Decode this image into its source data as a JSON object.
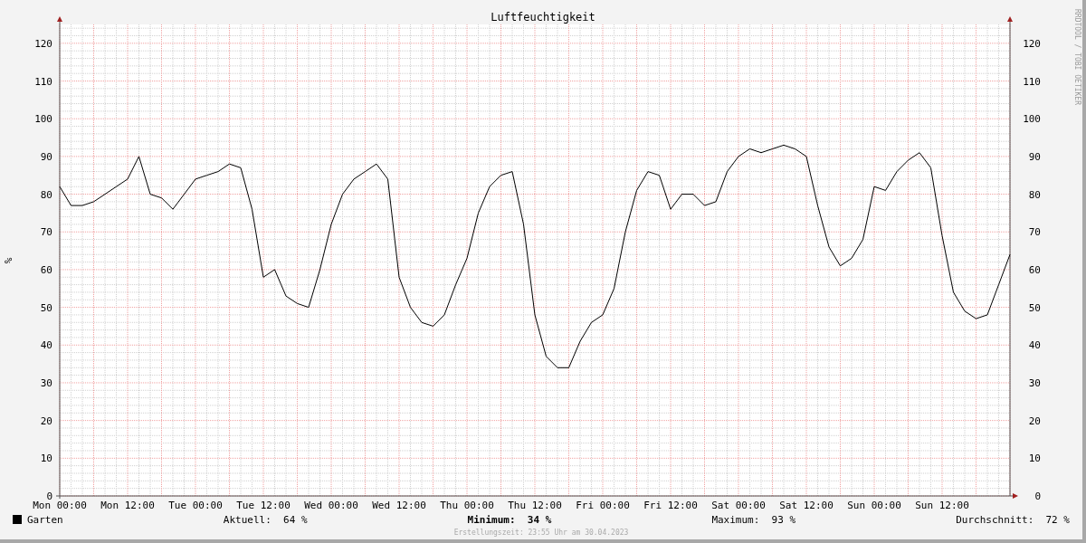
{
  "credit": "RRDTOOL / TOBI OETIKER",
  "chart_data": {
    "type": "line",
    "title": "Luftfeuchtigkeit",
    "ylabel": "%",
    "categories": [
      "Mon 00:00",
      null,
      null,
      null,
      null,
      null,
      "Mon 12:00",
      null,
      null,
      null,
      null,
      null,
      "Tue 00:00",
      null,
      null,
      null,
      null,
      null,
      "Tue 12:00",
      null,
      null,
      null,
      null,
      null,
      "Wed 00:00",
      null,
      null,
      null,
      null,
      null,
      "Wed 12:00",
      null,
      null,
      null,
      null,
      null,
      "Thu 00:00",
      null,
      null,
      null,
      null,
      null,
      "Thu 12:00",
      null,
      null,
      null,
      null,
      null,
      "Fri 00:00",
      null,
      null,
      null,
      null,
      null,
      "Fri 12:00",
      null,
      null,
      null,
      null,
      null,
      "Sat 00:00",
      null,
      null,
      null,
      null,
      null,
      "Sat 12:00",
      null,
      null,
      null,
      null,
      null,
      "Sun 00:00",
      null,
      null,
      null,
      null,
      null,
      "Sun 12:00",
      null,
      null,
      null,
      null,
      null,
      null
    ],
    "series": [
      {
        "name": "Garten",
        "color": "#000000",
        "values": [
          82,
          77,
          77,
          78,
          80,
          82,
          84,
          90,
          80,
          79,
          76,
          80,
          84,
          85,
          86,
          88,
          87,
          76,
          58,
          60,
          53,
          51,
          50,
          60,
          72,
          80,
          84,
          86,
          88,
          84,
          58,
          50,
          46,
          45,
          48,
          56,
          63,
          75,
          82,
          85,
          86,
          72,
          48,
          37,
          34,
          34,
          41,
          46,
          48,
          55,
          70,
          81,
          86,
          85,
          76,
          80,
          80,
          77,
          78,
          86,
          90,
          92,
          91,
          92,
          93,
          92,
          90,
          77,
          66,
          61,
          63,
          68,
          82,
          81,
          86,
          89,
          91,
          87,
          69,
          54,
          49,
          47,
          48,
          56,
          64
        ]
      }
    ],
    "ylim": [
      0,
      125
    ],
    "grid": true,
    "yticks": [
      0,
      10,
      20,
      30,
      40,
      50,
      60,
      70,
      80,
      90,
      100,
      110,
      120
    ]
  },
  "right_axis": {
    "ticks": [
      "120",
      "110",
      "100",
      "90",
      "80",
      "70",
      "60",
      "50",
      "40",
      "30",
      "20",
      "10",
      "0"
    ]
  },
  "legend": {
    "stats": [
      {
        "label": "Aktuell:",
        "value": "64 %",
        "emphasized": false
      },
      {
        "label": "Minimum:",
        "value": "34 %",
        "emphasized": true
      },
      {
        "label": "Maximum:",
        "value": "93 %",
        "emphasized": false
      },
      {
        "label": "Durchschnitt:",
        "value": "72 %",
        "emphasized": false
      }
    ]
  },
  "footer": "Erstellungszeit: 23:55 Uhr am 30.04.2023"
}
